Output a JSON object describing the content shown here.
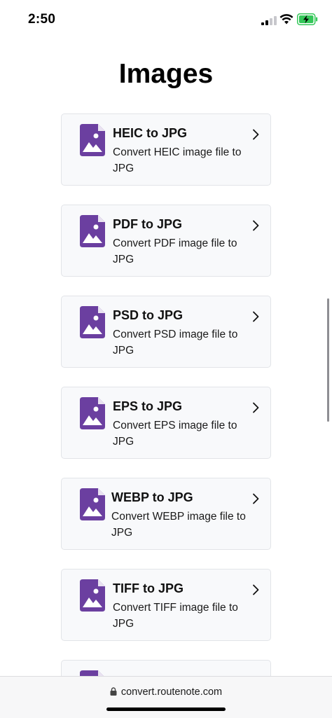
{
  "status_bar": {
    "time": "2:50"
  },
  "page": {
    "title": "Images"
  },
  "cards": [
    {
      "title": "HEIC to JPG",
      "description": "Convert HEIC image file to JPG"
    },
    {
      "title": "PDF to JPG",
      "description": "Convert PDF image file to JPG"
    },
    {
      "title": "PSD to JPG",
      "description": "Convert PSD image file to JPG"
    },
    {
      "title": "EPS to JPG",
      "description": "Convert EPS image file to JPG"
    },
    {
      "title": "WEBP to JPG",
      "description": "Convert WEBP image file to JPG"
    },
    {
      "title": "TIFF to JPG",
      "description": "Convert TIFF image file to JPG"
    }
  ],
  "url_bar": {
    "url": "convert.routenote.com"
  },
  "icons": {
    "card": "image-file-icon",
    "chevron": "chevron-right-icon",
    "lock": "lock-icon",
    "signal": "cellular-signal-icon",
    "wifi": "wifi-icon",
    "battery": "battery-charging-icon"
  },
  "colors": {
    "accent": "#6b3fa0",
    "card_bg": "#f8f9fb",
    "card_border": "#e2e4e8",
    "battery": "#34c759"
  }
}
